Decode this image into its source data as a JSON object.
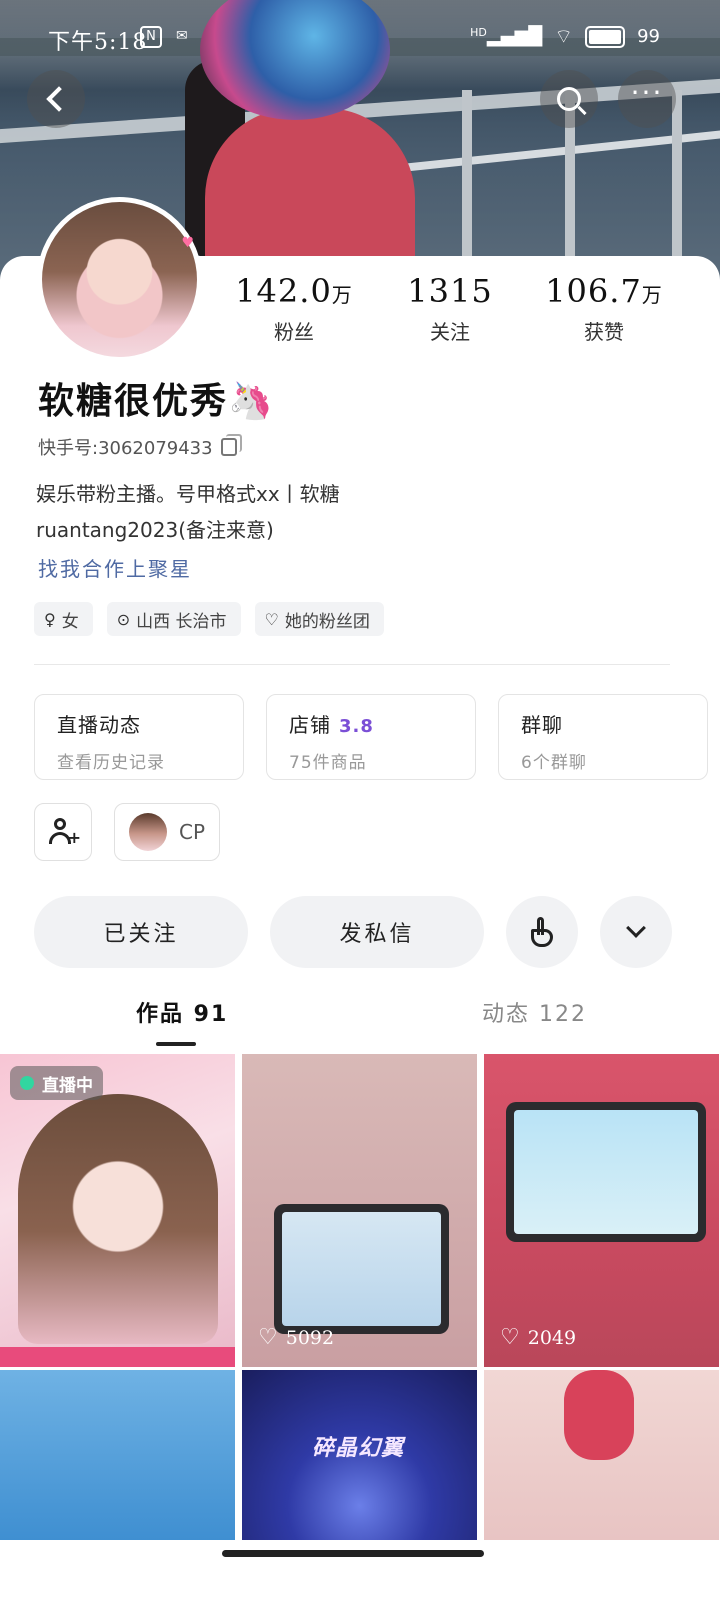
{
  "status_bar": {
    "time": "下午5:18",
    "nfc": "N",
    "network": "HD",
    "battery": "99"
  },
  "nav": {
    "back_icon": "back-arrow-icon",
    "search_icon": "search-icon",
    "more_icon": "more-dots-icon"
  },
  "stats": {
    "fans": {
      "value": "142.0",
      "unit": "万",
      "label": "粉丝"
    },
    "following": {
      "value": "1315",
      "unit": "",
      "label": "关注"
    },
    "likes": {
      "value": "106.7",
      "unit": "万",
      "label": "获赞"
    }
  },
  "profile": {
    "name": "软糖很优秀🦄",
    "uid": "快手号:3062079433",
    "bio_line1": "娱乐带粉主播。号甲格式xx丨软糖",
    "bio_line2": "ruantang2023(备注来意)",
    "coop": "找我合作上聚星"
  },
  "tags": [
    {
      "icon": "gender-female-icon",
      "label": "女"
    },
    {
      "icon": "location-pin-icon",
      "label": "山西 长治市"
    },
    {
      "icon": "fan-group-heart-icon",
      "label": "她的粉丝团"
    }
  ],
  "cards": [
    {
      "title": "直播动态",
      "badge": "",
      "sub": "查看历史记录"
    },
    {
      "title": "店铺",
      "badge": "3.8",
      "sub": "75件商品"
    },
    {
      "title": "群聊",
      "badge": "",
      "sub": "6个群聊"
    }
  ],
  "cp": {
    "label": "CP"
  },
  "actions": {
    "followed": "已关注",
    "message": "发私信"
  },
  "tabs": {
    "works": "作品 91",
    "moments": "动态 122"
  },
  "grid": [
    {
      "live": "直播中",
      "likes": ""
    },
    {
      "live": "",
      "likes": "5092"
    },
    {
      "live": "",
      "likes": "2049"
    },
    {
      "live": "",
      "likes": ""
    },
    {
      "live": "",
      "likes": "",
      "title": "碎晶幻翼"
    },
    {
      "live": "",
      "likes": ""
    }
  ]
}
